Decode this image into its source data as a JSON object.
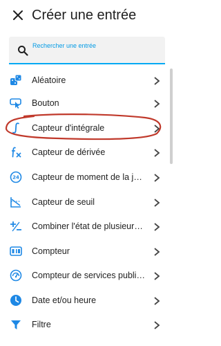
{
  "dialog": {
    "title": "Créer une entrée",
    "close_icon": "close-icon"
  },
  "search": {
    "placeholder": "Rechercher une entrée",
    "accent_color": "#03a9f4",
    "icon": "search-icon"
  },
  "list": {
    "icon_color": "#1e88e5",
    "items": [
      {
        "label": "Aléatoire",
        "icon": "dice-icon"
      },
      {
        "label": "Bouton",
        "icon": "button-press-icon"
      },
      {
        "label": "Capteur d'intégrale",
        "icon": "integral-icon"
      },
      {
        "label": "Capteur de dérivée",
        "icon": "derivative-icon"
      },
      {
        "label": "Capteur de moment de la journée",
        "icon": "clock-24h-icon"
      },
      {
        "label": "Capteur de seuil",
        "icon": "threshold-icon"
      },
      {
        "label": "Combiner l'état de plusieurs capteurs",
        "icon": "plus-minus-icon"
      },
      {
        "label": "Compteur",
        "icon": "counter-icon"
      },
      {
        "label": "Compteur de services publics (électricité, gaz, eau)",
        "icon": "utility-meter-icon"
      },
      {
        "label": "Date et/ou heure",
        "icon": "clock-icon"
      },
      {
        "label": "Filtre",
        "icon": "filter-icon"
      }
    ]
  },
  "annotation": {
    "color": "#c0392b",
    "shape": "ellipse"
  }
}
